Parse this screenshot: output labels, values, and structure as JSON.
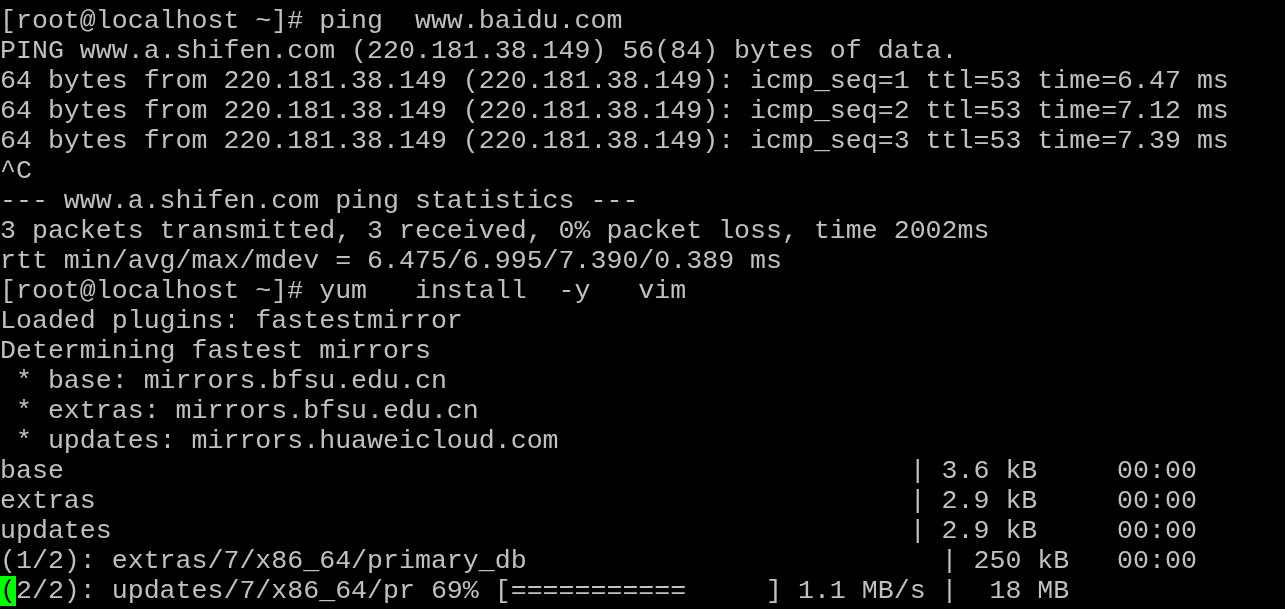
{
  "terminal": {
    "lines": [
      {
        "kind": "text",
        "text": "[root@localhost ~]# ping  www.baidu.com"
      },
      {
        "kind": "text",
        "text": "PING www.a.shifen.com (220.181.38.149) 56(84) bytes of data."
      },
      {
        "kind": "text",
        "text": "64 bytes from 220.181.38.149 (220.181.38.149): icmp_seq=1 ttl=53 time=6.47 ms"
      },
      {
        "kind": "text",
        "text": "64 bytes from 220.181.38.149 (220.181.38.149): icmp_seq=2 ttl=53 time=7.12 ms"
      },
      {
        "kind": "text",
        "text": "64 bytes from 220.181.38.149 (220.181.38.149): icmp_seq=3 ttl=53 time=7.39 ms"
      },
      {
        "kind": "text",
        "text": "^C"
      },
      {
        "kind": "text",
        "text": "--- www.a.shifen.com ping statistics ---"
      },
      {
        "kind": "text",
        "text": "3 packets transmitted, 3 received, 0% packet loss, time 2002ms"
      },
      {
        "kind": "text",
        "text": "rtt min/avg/max/mdev = 6.475/6.995/7.390/0.389 ms"
      },
      {
        "kind": "text",
        "text": "[root@localhost ~]# yum   install  -y   vim"
      },
      {
        "kind": "text",
        "text": "Loaded plugins: fastestmirror"
      },
      {
        "kind": "text",
        "text": "Determining fastest mirrors"
      },
      {
        "kind": "text",
        "text": " * base: mirrors.bfsu.edu.cn"
      },
      {
        "kind": "text",
        "text": " * extras: mirrors.bfsu.edu.cn"
      },
      {
        "kind": "text",
        "text": " * updates: mirrors.huaweicloud.com"
      },
      {
        "kind": "text",
        "text": "base                                                     | 3.6 kB     00:00"
      },
      {
        "kind": "text",
        "text": "extras                                                   | 2.9 kB     00:00"
      },
      {
        "kind": "text",
        "text": "updates                                                  | 2.9 kB     00:00"
      },
      {
        "kind": "text",
        "text": "(1/2): extras/7/x86_64/primary_db                          | 250 kB   00:00"
      },
      {
        "kind": "cursor",
        "cursor": "(",
        "text": "2/2): updates/7/x86_64/pr 69% [===========     ] 1.1 MB/s |  18 MB"
      }
    ]
  }
}
